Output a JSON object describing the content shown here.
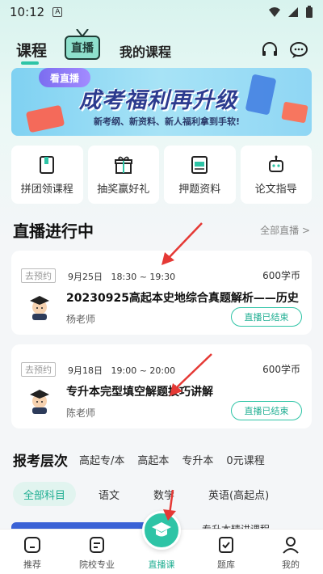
{
  "status_bar": {
    "time": "10:12",
    "notify_glyph": "A"
  },
  "header": {
    "tab_course": "课程",
    "tab_live": "直播",
    "tab_my_course": "我的课程",
    "icons": [
      "headset-icon",
      "chat-icon"
    ]
  },
  "banner": {
    "badge": "看直播",
    "title": "成考福利再升级",
    "subtitle": "新考纲、新资料、新人福利拿到手软!"
  },
  "quick_entries": [
    {
      "label": "拼团领课程",
      "icon": "book-icon"
    },
    {
      "label": "抽奖赢好礼",
      "icon": "gift-icon"
    },
    {
      "label": "押题资料",
      "icon": "exam-paper-icon"
    },
    {
      "label": "论文指导",
      "icon": "robot-icon"
    }
  ],
  "live_section": {
    "title": "直播进行中",
    "more": "全部直播 >"
  },
  "live_cards": [
    {
      "tag": "去预约",
      "date": "9月25日",
      "time": "18:30 ~ 19:30",
      "price": "600学币",
      "title": "20230925高起本史地综合真题解析——历史",
      "teacher": "杨老师",
      "status": "直播已结束"
    },
    {
      "tag": "去预约",
      "date": "9月18日",
      "time": "19:00 ~ 20:00",
      "price": "600学币",
      "title": "专升本完型填空解题技巧讲解",
      "teacher": "陈老师",
      "status": "直播已结束"
    }
  ],
  "levels": {
    "label": "报考层次",
    "options": [
      "高起专/本",
      "高起本",
      "专升本",
      "0元课程"
    ]
  },
  "subjects": {
    "active": "全部科目",
    "options": [
      "语文",
      "数学",
      "英语(高起点)"
    ]
  },
  "peek_text": "专升本精讲课程",
  "bottom_nav": [
    {
      "label": "推荐",
      "icon": "home-icon"
    },
    {
      "label": "院校专业",
      "icon": "document-icon"
    },
    {
      "label": "直播课",
      "icon": "graduation-cap-icon",
      "active": true
    },
    {
      "label": "题库",
      "icon": "checklist-icon"
    },
    {
      "label": "我的",
      "icon": "person-icon"
    }
  ],
  "colors": {
    "accent": "#2ec4a6",
    "annotation_arrow": "#e53935"
  }
}
